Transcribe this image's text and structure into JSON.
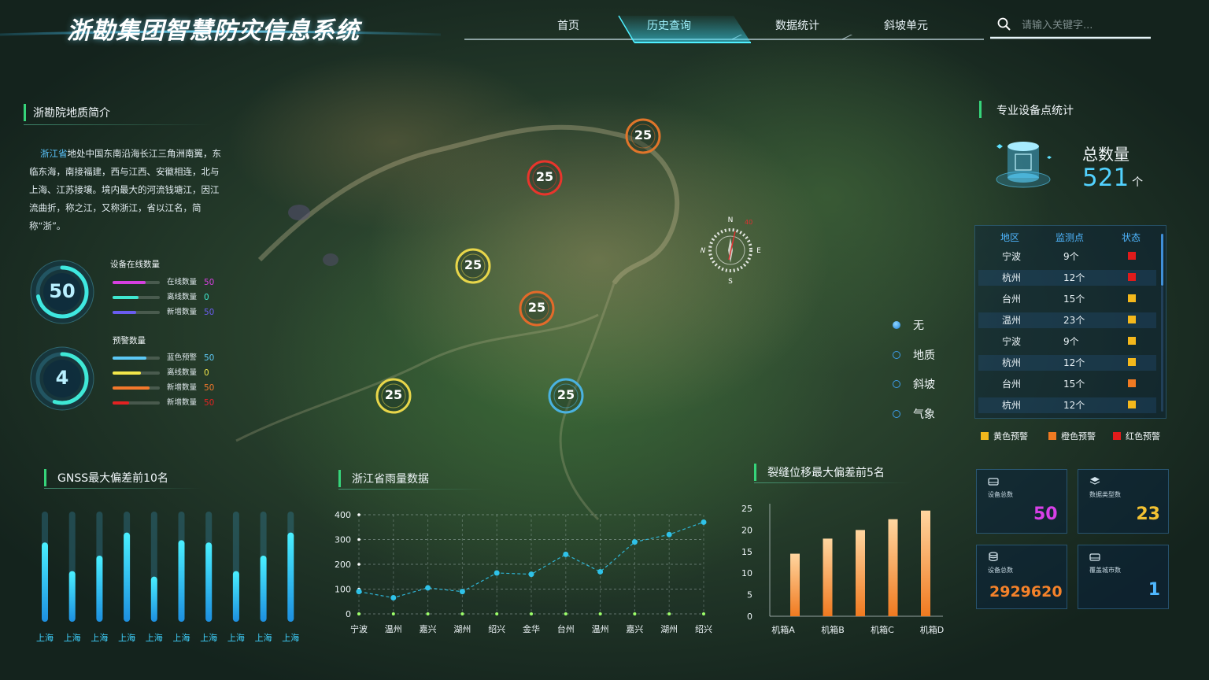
{
  "header": {
    "title": "浙勘集团智慧防灾信息系统",
    "nav": [
      {
        "label": "首页",
        "active": false
      },
      {
        "label": "历史查询",
        "active": true
      },
      {
        "label": "数据统计",
        "active": false
      },
      {
        "label": "斜坡单元",
        "active": false
      }
    ],
    "search_placeholder": "请输入关键字..."
  },
  "intro": {
    "title": "浙勘院地质简介",
    "highlight": "浙江省",
    "text": "地处中国东南沿海长江三角洲南翼，东临东海，南接福建，西与江西、安徽相连，北与上海、江苏接壤。境内最大的河流钱塘江，因江流曲折，称之江，又称浙江，省以江名，简称“浙”。"
  },
  "online": {
    "title": "设备在线数量",
    "value": "50",
    "gauge_fraction": 0.72,
    "rows": [
      {
        "label": "在线数量",
        "value": "50",
        "color": "#d63fe0",
        "fraction": 0.7
      },
      {
        "label": "离线数量",
        "value": "0",
        "color": "#3fe8d0",
        "fraction": 0.55
      },
      {
        "label": "新增数量",
        "value": "50",
        "color": "#6a5cf0",
        "fraction": 0.5
      }
    ]
  },
  "warning": {
    "title": "预警数量",
    "value": "4",
    "gauge_fraction": 0.55,
    "rows": [
      {
        "label": "蓝色预警",
        "value": "50",
        "color": "#5cc8f5",
        "fraction": 0.72
      },
      {
        "label": "离线数量",
        "value": "0",
        "color": "#f3e64a",
        "fraction": 0.6
      },
      {
        "label": "新增数量",
        "value": "50",
        "color": "#f2782c",
        "fraction": 0.78
      },
      {
        "label": "新增数量",
        "value": "50",
        "color": "#e32222",
        "fraction": 0.35
      }
    ]
  },
  "map": {
    "markers": [
      {
        "value": "25",
        "color": "#e0752a"
      },
      {
        "value": "25",
        "color": "#e8352c"
      },
      {
        "value": "25",
        "color": "#e8d64a"
      },
      {
        "value": "25",
        "color": "#e36a2a"
      },
      {
        "value": "25",
        "color": "#e8d64a"
      },
      {
        "value": "25",
        "color": "#4ab2e0"
      }
    ],
    "compass": {
      "n": "N",
      "s": "S",
      "e": "E",
      "w": "W",
      "deg": "40"
    },
    "layers": [
      {
        "label": "无",
        "selected": true
      },
      {
        "label": "地质",
        "selected": false
      },
      {
        "label": "斜坡",
        "selected": false
      },
      {
        "label": "气象",
        "selected": false
      }
    ]
  },
  "equipment": {
    "title": "专业设备点统计",
    "total_label": "总数量",
    "total_value": "521",
    "total_unit": "个",
    "columns": [
      "地区",
      "监测点",
      "状态"
    ],
    "rows": [
      {
        "region": "宁波",
        "count": "9个",
        "status": "#e01b1b"
      },
      {
        "region": "杭州",
        "count": "12个",
        "status": "#e01b1b"
      },
      {
        "region": "台州",
        "count": "15个",
        "status": "#f4b81c"
      },
      {
        "region": "温州",
        "count": "23个",
        "status": "#f4b81c"
      },
      {
        "region": "宁波",
        "count": "9个",
        "status": "#f4b81c"
      },
      {
        "region": "杭州",
        "count": "12个",
        "status": "#f4b81c"
      },
      {
        "region": "台州",
        "count": "15个",
        "status": "#f07a22"
      },
      {
        "region": "杭州",
        "count": "12个",
        "status": "#f4b81c"
      }
    ],
    "legend": [
      {
        "label": "黄色预警",
        "color": "#f4b81c"
      },
      {
        "label": "橙色预警",
        "color": "#f07a22"
      },
      {
        "label": "红色预警",
        "color": "#e01b1b"
      }
    ]
  },
  "cards": [
    {
      "label": "设备总数",
      "value": "50",
      "color": "#d840e8",
      "icon": "hard-drive-icon"
    },
    {
      "label": "数据类型数",
      "value": "23",
      "color": "#f3c232",
      "icon": "layers-icon"
    },
    {
      "label": "设备总数",
      "value": "2929620",
      "color": "#f5822a",
      "icon": "database-icon"
    },
    {
      "label": "覆盖城市数",
      "value": "1",
      "color": "#4fb8ff",
      "icon": "hard-drive-icon"
    }
  ],
  "chart_data": [
    {
      "type": "bar",
      "title": "GNSS最大偏差前10名",
      "categories": [
        "上海",
        "上海",
        "上海",
        "上海",
        "上海",
        "上海",
        "上海",
        "上海",
        "上海",
        "上海"
      ],
      "values": [
        0.72,
        0.46,
        0.6,
        0.81,
        0.41,
        0.74,
        0.72,
        0.46,
        0.6,
        0.81
      ],
      "ylim": [
        0,
        1
      ]
    },
    {
      "type": "line",
      "title": "浙江省雨量数据",
      "categories": [
        "宁波",
        "温州",
        "嘉兴",
        "湖州",
        "绍兴",
        "金华",
        "台州",
        "温州",
        "嘉兴",
        "湖州",
        "绍兴"
      ],
      "values": [
        90,
        65,
        105,
        90,
        165,
        160,
        240,
        170,
        290,
        320,
        370
      ],
      "yticks": [
        "0",
        "100",
        "200",
        "300",
        "400"
      ],
      "ylim": [
        0,
        400
      ]
    },
    {
      "type": "bar",
      "title": "裂缝位移最大偏差前5名",
      "categories": [
        "机箱A",
        "机箱B",
        "机箱C",
        "机箱D"
      ],
      "values": [
        14.5,
        18,
        20,
        22.5,
        24.5
      ],
      "yticks": [
        "0",
        "5",
        "10",
        "15",
        "20",
        "25"
      ],
      "ylim": [
        0,
        25
      ]
    }
  ]
}
